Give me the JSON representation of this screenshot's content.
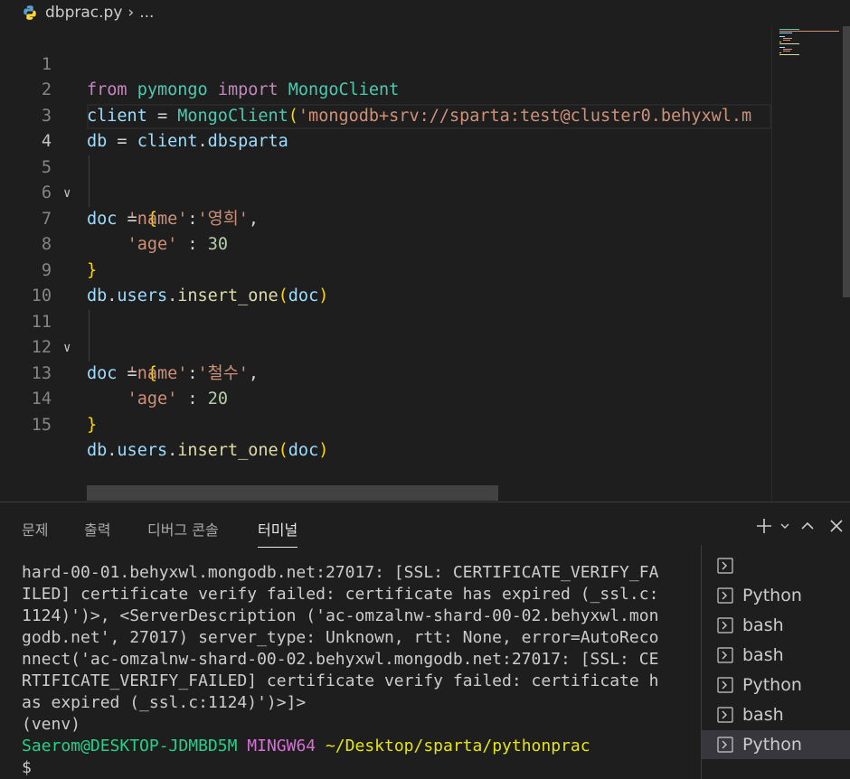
{
  "breadcrumb": {
    "file": "dbprac.py",
    "more": "..."
  },
  "editor": {
    "lines": [
      {
        "n": "1"
      },
      {
        "n": "2"
      },
      {
        "n": "3"
      },
      {
        "n": "4"
      },
      {
        "n": "5"
      },
      {
        "n": "6"
      },
      {
        "n": "7"
      },
      {
        "n": "8"
      },
      {
        "n": "9"
      },
      {
        "n": "10"
      },
      {
        "n": "11"
      },
      {
        "n": "12"
      },
      {
        "n": "13"
      },
      {
        "n": "14"
      },
      {
        "n": "15"
      }
    ],
    "tokens": {
      "from": "from",
      "pymongo": "pymongo",
      "import": "import",
      "MongoClient": "MongoClient",
      "client": "client",
      "eq": " = ",
      "conn_str": "'mongodb+srv://sparta:test@cluster0.behyxwl.m",
      "db": "db",
      "dot": ".",
      "dbsparta": "dbsparta",
      "doc": "doc",
      "lbrace": "{",
      "rbrace": "}",
      "name_key": "'name'",
      "colon": ":",
      "name1": "'영희'",
      "comma": ",",
      "age_key": "'age'",
      "colon_sp": " : ",
      "age1": "30",
      "users": "users",
      "insert_one": "insert_one",
      "lparen": "(",
      "rparen": ")",
      "name2": "'철수'",
      "age2": "20"
    }
  },
  "panel": {
    "tabs": [
      "문제",
      "출력",
      "디버그 콘솔",
      "터미널"
    ],
    "active_tab": "터미널",
    "terminal": {
      "output": [
        "hard-00-01.behyxwl.mongodb.net:27017: [SSL: CERTIFICATE_VERIFY_FA",
        "ILED] certificate verify failed: certificate has expired (_ssl.c:",
        "1124)')>, <ServerDescription ('ac-omzalnw-shard-00-02.behyxwl.mon",
        "godb.net', 27017) server_type: Unknown, rtt: None, error=AutoReco",
        "nnect('ac-omzalnw-shard-00-02.behyxwl.mongodb.net:27017: [SSL: CE",
        "RTIFICATE_VERIFY_FAILED] certificate verify failed: certificate h",
        "as expired (_ssl.c:1124)')>]>",
        "(venv)"
      ],
      "prompt_user": "Saerom@DESKTOP-JDMBD5M",
      "prompt_env": "MINGW64",
      "prompt_path": "~/Desktop/sparta/pythonprac",
      "prompt_symbol": "$"
    },
    "terminal_list": [
      "",
      "Python",
      "bash",
      "bash",
      "Python",
      "bash",
      "Python"
    ],
    "selected_terminal_index": 6
  },
  "colors": {
    "keyword": "#c586c0",
    "class": "#4ec9b0",
    "string": "#ce9178",
    "number": "#b5cea8",
    "variable": "#9cdcfe",
    "function": "#dcdcaa"
  }
}
